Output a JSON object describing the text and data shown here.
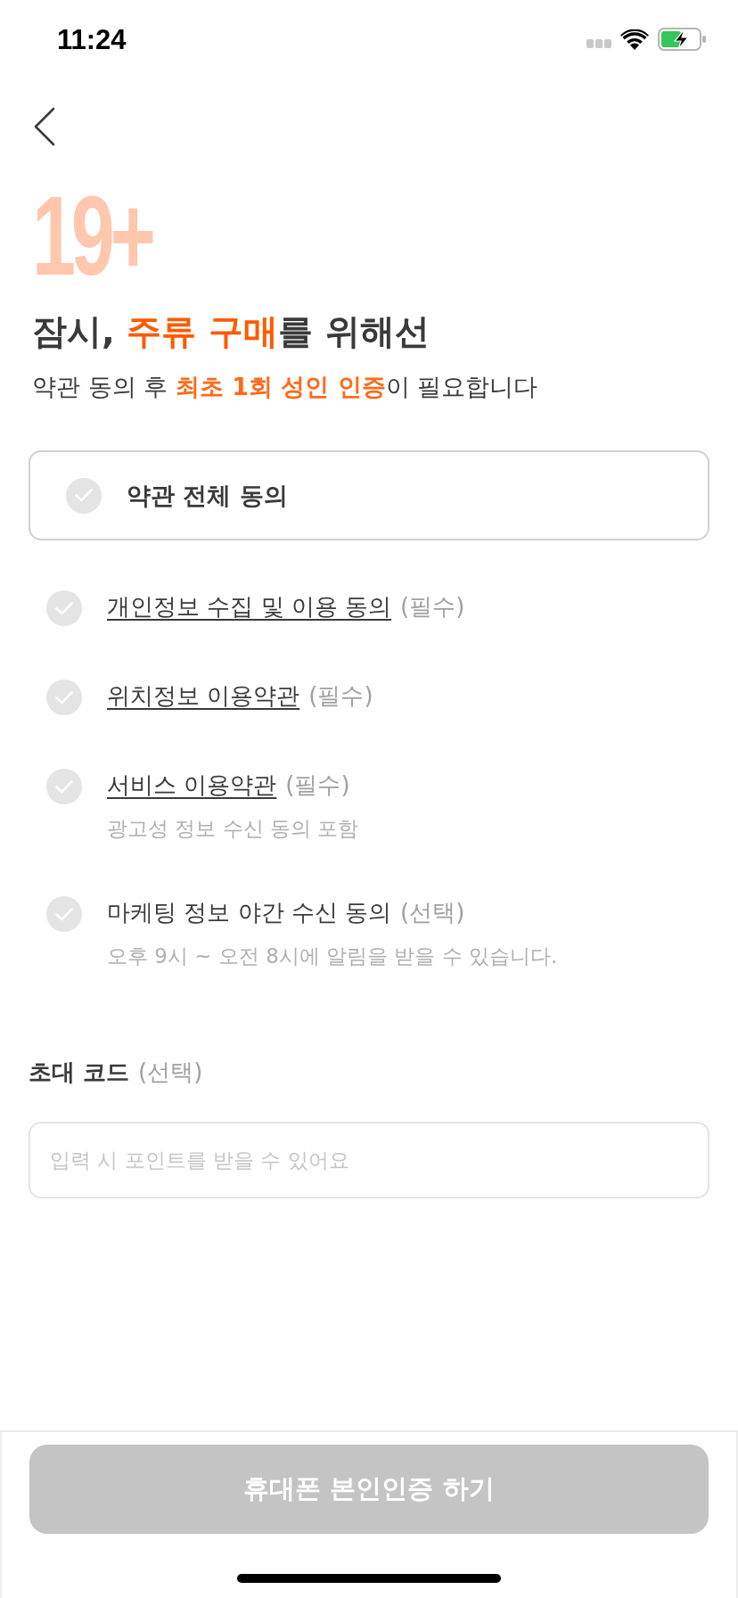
{
  "status_bar": {
    "time": "11:24"
  },
  "hero": {
    "badge": "19+",
    "title_parts": [
      {
        "text": "잠시, ",
        "highlight": false
      },
      {
        "text": "주류 구매",
        "highlight": true
      },
      {
        "text": "를 위해선",
        "highlight": false
      }
    ],
    "subtitle_parts": [
      {
        "text": "약관 동의 후 ",
        "highlight": false
      },
      {
        "text": "최초 1회 성인 인증",
        "highlight": true
      },
      {
        "text": "이 필요합니다",
        "highlight": false
      }
    ]
  },
  "agree_all": {
    "label": "약관 전체 동의",
    "checked": false
  },
  "terms": [
    {
      "kind": "link",
      "label": "개인정보 수집 및 이용 동의",
      "requirement": "(필수)",
      "checked": false
    },
    {
      "kind": "link",
      "label": "위치정보 이용약관",
      "requirement": "(필수)",
      "checked": false
    },
    {
      "kind": "link",
      "label": "서비스 이용약관",
      "requirement": "(필수)",
      "note": "광고성 정보 수신 동의 포함",
      "checked": false
    },
    {
      "kind": "plain",
      "label": "마케팅 정보 야간 수신 동의",
      "requirement": "(선택)",
      "note": "오후 9시 ~ 오전 8시에 알림을 받을 수 있습니다.",
      "checked": false
    }
  ],
  "invite_code": {
    "label": "초대 코드",
    "requirement": "(선택)",
    "placeholder": "입력 시 포인트를 받을 수 있어요"
  },
  "submit_button": {
    "label": "휴대폰 본인인증 하기",
    "disabled": true
  }
}
